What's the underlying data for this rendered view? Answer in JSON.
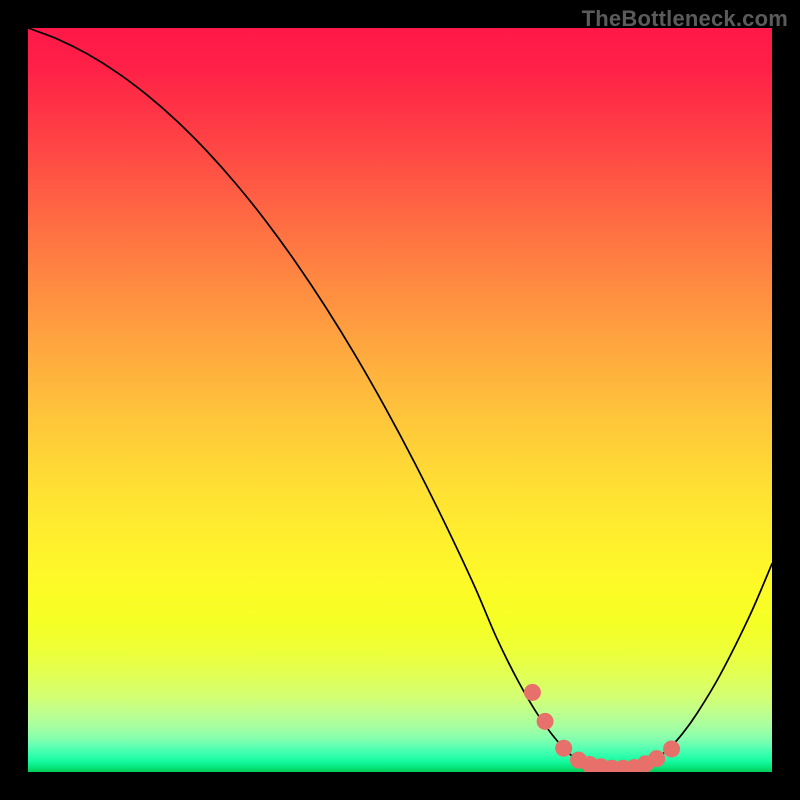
{
  "watermark": "TheBottleneck.com",
  "chart_data": {
    "type": "line",
    "title": "",
    "xlabel": "",
    "ylabel": "",
    "xlim": [
      0,
      100
    ],
    "ylim": [
      0,
      100
    ],
    "grid": false,
    "legend": false,
    "series": [
      {
        "name": "curve",
        "x": [
          0,
          4,
          8,
          12,
          16,
          20,
          24,
          28,
          32,
          36,
          40,
          44,
          48,
          52,
          56,
          60,
          63,
          66,
          69,
          72,
          74,
          76,
          78,
          80,
          82,
          84,
          86,
          88,
          90,
          93,
          97,
          100
        ],
        "values": [
          100,
          98.5,
          96.5,
          94,
          91,
          87.5,
          83.5,
          79,
          74,
          68.5,
          62.5,
          56,
          49,
          41.5,
          33.5,
          25,
          18,
          12,
          7,
          3.2,
          1.6,
          0.8,
          0.5,
          0.5,
          0.8,
          1.6,
          3.0,
          5.2,
          8.0,
          13,
          21,
          28
        ],
        "color": "#000000",
        "width": 1.7
      },
      {
        "name": "markers",
        "type": "scatter",
        "x": [
          67.8,
          69.5,
          72.0,
          74.0,
          75.5,
          77.0,
          78.5,
          80.0,
          81.5,
          83.0,
          84.5,
          86.5
        ],
        "values": [
          10.7,
          6.8,
          3.2,
          1.6,
          1.0,
          0.7,
          0.5,
          0.5,
          0.6,
          1.1,
          1.8,
          3.1
        ],
        "color": "#e7706a",
        "radius": 8.5
      }
    ],
    "gradient_stops": [
      {
        "offset": 0.0,
        "color": "#ff1848"
      },
      {
        "offset": 0.05,
        "color": "#ff2047"
      },
      {
        "offset": 0.1,
        "color": "#ff3046"
      },
      {
        "offset": 0.15,
        "color": "#ff4245"
      },
      {
        "offset": 0.2,
        "color": "#ff5544"
      },
      {
        "offset": 0.25,
        "color": "#ff6843"
      },
      {
        "offset": 0.3,
        "color": "#ff7a42"
      },
      {
        "offset": 0.35,
        "color": "#ff8c41"
      },
      {
        "offset": 0.4,
        "color": "#ff9d40"
      },
      {
        "offset": 0.45,
        "color": "#ffae3e"
      },
      {
        "offset": 0.5,
        "color": "#ffbe3c"
      },
      {
        "offset": 0.55,
        "color": "#ffcd39"
      },
      {
        "offset": 0.6,
        "color": "#ffdb35"
      },
      {
        "offset": 0.65,
        "color": "#ffe731"
      },
      {
        "offset": 0.7,
        "color": "#fff22c"
      },
      {
        "offset": 0.75,
        "color": "#fdfa27"
      },
      {
        "offset": 0.8,
        "color": "#f5ff25"
      },
      {
        "offset": 0.84,
        "color": "#ecff3a"
      },
      {
        "offset": 0.87,
        "color": "#e1ff55"
      },
      {
        "offset": 0.9,
        "color": "#d2ff74"
      },
      {
        "offset": 0.92,
        "color": "#beff8e"
      },
      {
        "offset": 0.94,
        "color": "#a4ffa2"
      },
      {
        "offset": 0.955,
        "color": "#85ffae"
      },
      {
        "offset": 0.965,
        "color": "#62ffb2"
      },
      {
        "offset": 0.975,
        "color": "#3bffaf"
      },
      {
        "offset": 0.985,
        "color": "#17fba0"
      },
      {
        "offset": 0.993,
        "color": "#07e880"
      },
      {
        "offset": 1.0,
        "color": "#02cb55"
      }
    ]
  }
}
